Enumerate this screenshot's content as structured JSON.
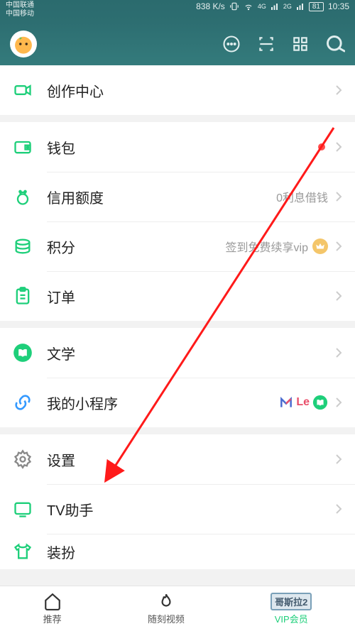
{
  "status": {
    "carrier1": "中国联通",
    "carrier2": "中国移动",
    "speed": "838 K/s",
    "battery": "81",
    "time": "10:35"
  },
  "menu": {
    "creator_center": "创作中心",
    "wallet": "钱包",
    "credit": "信用额度",
    "credit_meta": "0利息借钱",
    "points": "积分",
    "points_meta": "签到免费续享vip",
    "orders": "订单",
    "literature": "文学",
    "mini_programs": "我的小程序",
    "settings": "设置",
    "tv_assistant": "TV助手",
    "dress_up": "装扮"
  },
  "nav": {
    "recommend": "推荐",
    "random_video": "随刻视频",
    "godzilla": "哥斯拉2",
    "vip": "VIP会员"
  },
  "mini_le": "Le"
}
